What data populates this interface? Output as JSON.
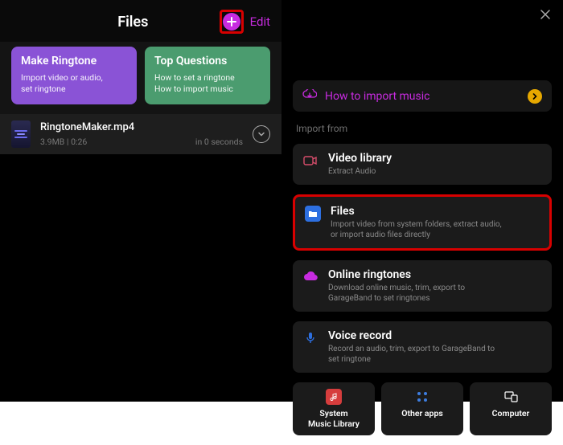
{
  "left": {
    "title": "Files",
    "edit": "Edit",
    "cards": {
      "make_ringtone": {
        "title": "Make Ringtone",
        "sub": "Import video or audio,\nset ringtone"
      },
      "top_questions": {
        "title": "Top Questions",
        "sub": "How to set a ringtone\nHow to import music"
      }
    },
    "file": {
      "name": "RingtoneMaker.mp4",
      "size": "3.9MB",
      "duration": "0:26",
      "age": "in 0 seconds"
    }
  },
  "right": {
    "hint": "How to import music",
    "section": "Import from",
    "items": {
      "video": {
        "title": "Video library",
        "sub": "Extract Audio"
      },
      "files": {
        "title": "Files",
        "sub": "Import video from system folders, extract audio,\nor import audio files directly"
      },
      "online": {
        "title": "Online ringtones",
        "sub": "Download online music, trim, export to\nGarageBand to set ringtones"
      },
      "voice": {
        "title": "Voice record",
        "sub": "Record an audio, trim, export to GarageBand to\nset ringtone"
      }
    },
    "bottom": {
      "system": "System\nMusic Library",
      "other": "Other apps",
      "computer": "Computer"
    }
  }
}
